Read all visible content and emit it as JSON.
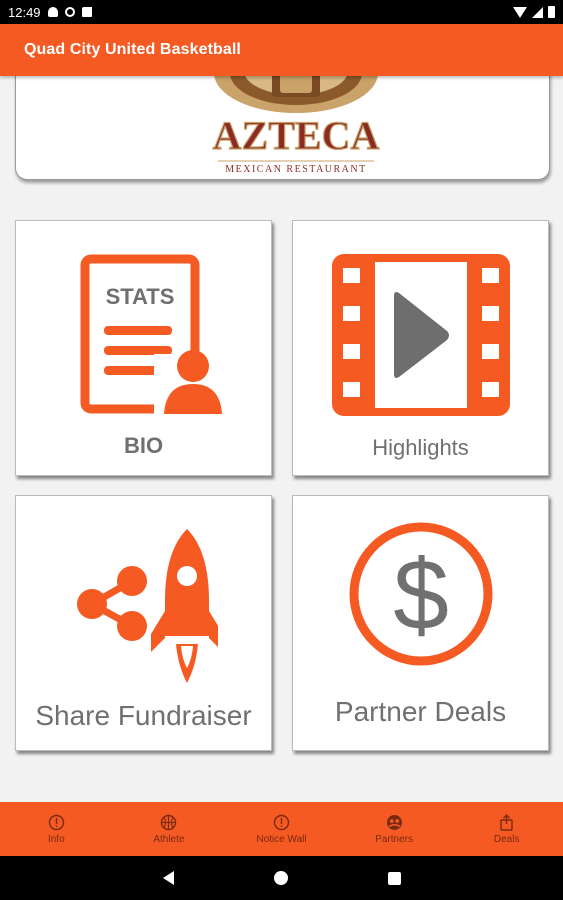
{
  "status_bar": {
    "time": "12:49"
  },
  "app_bar": {
    "title": "Quad City United Basketball"
  },
  "banner": {
    "sponsor_name": "AZTECA",
    "sponsor_subtitle": "MEXICAN RESTAURANT"
  },
  "tiles": {
    "bio": {
      "label": "BIO",
      "icon_text": "STATS",
      "icon": "stats-document-icon"
    },
    "highlights": {
      "label": "Highlights",
      "icon": "film-play-icon"
    },
    "share": {
      "label": "Share Fundraiser",
      "icon": "share-rocket-icon"
    },
    "partner": {
      "label": "Partner Deals",
      "icon_text": "$",
      "icon": "dollar-circle-icon"
    }
  },
  "bottom_nav": {
    "items": [
      {
        "label": "Info",
        "icon": "info-icon"
      },
      {
        "label": "Athlete",
        "icon": "basketball-icon"
      },
      {
        "label": "Notice Wall",
        "icon": "alert-icon"
      },
      {
        "label": "Partners",
        "icon": "partners-icon"
      },
      {
        "label": "Deals",
        "icon": "deals-icon"
      }
    ]
  },
  "colors": {
    "accent": "#f55a23",
    "text_gray": "#707070",
    "nav_label": "#7a2a12",
    "sponsor_red": "#8b2c24",
    "sponsor_gold": "#c9a36a"
  }
}
